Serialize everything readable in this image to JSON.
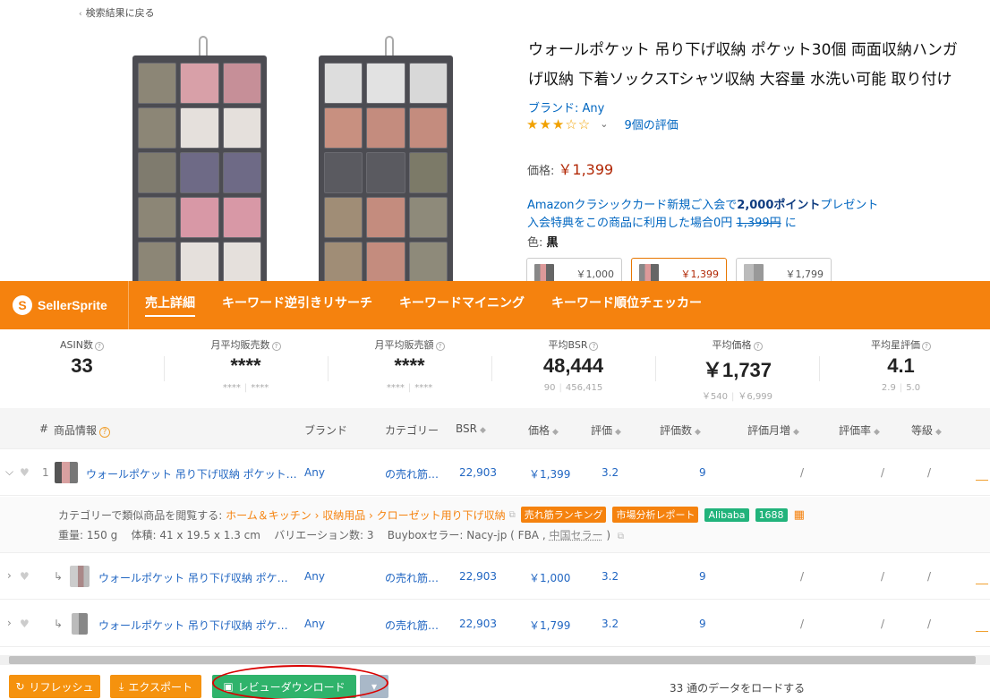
{
  "breadcrumb": {
    "back_label": "検索結果に戻る"
  },
  "product": {
    "title_line1": "ウォールポケット 吊り下げ収納 ポケット30個 両面収納ハンガ",
    "title_line2": "げ収納 下着ソックスTシャツ収納 大容量 水洗い可能 取り付け",
    "brand": "ブランド: Any",
    "stars": "★★★☆☆",
    "review_count": "9個の評価",
    "price_label": "価格:",
    "price": "￥1,399",
    "promo_line1_prefix": "Amazonクラシックカード新規ご入会で",
    "promo_points": "2,000ポイント",
    "promo_line1_suffix": "プレゼント",
    "promo_line2_prefix": "入会特典をこの商品に利用した場合0円",
    "promo_strike": "1,399円",
    "promo_line2_suffix": "に",
    "color_label": "色:",
    "color_value": "黒",
    "variants": [
      {
        "price": "￥1,000"
      },
      {
        "price": "￥1,399"
      },
      {
        "price": "￥1,799"
      }
    ]
  },
  "sellersprite": {
    "logo": "SellerSprite",
    "nav": [
      "売上詳細",
      "キーワード逆引きリサーチ",
      "キーワードマイニング",
      "キーワード順位チェッカー"
    ]
  },
  "stats": [
    {
      "label": "ASIN数",
      "value": "33",
      "min": "",
      "max": ""
    },
    {
      "label": "月平均販売数",
      "value": "****",
      "min": "****",
      "max": "****"
    },
    {
      "label": "月平均販売額",
      "value": "****",
      "min": "****",
      "max": "****"
    },
    {
      "label": "平均BSR",
      "value": "48,444",
      "min": "90",
      "max": "456,415"
    },
    {
      "label": "平均価格",
      "value": "￥1,737",
      "min": "￥540",
      "max": "￥6,999"
    },
    {
      "label": "平均星評価",
      "value": "4.1",
      "min": "2.9",
      "max": "5.0"
    }
  ],
  "table": {
    "headers": {
      "num": "#",
      "info": "商品情報",
      "brand": "ブランド",
      "category": "カテゴリー",
      "bsr": "BSR",
      "price": "価格",
      "rating": "評価",
      "reviews": "評価数",
      "review_growth": "評価月増",
      "review_rate": "評価率",
      "grade": "等級"
    },
    "rows": [
      {
        "num": "1",
        "title": "ウォールポケット 吊り下げ収納 ポケット…",
        "brand": "Any",
        "category": "の売れ筋…",
        "bsr": "22,903",
        "price": "￥1,399",
        "rating": "3.2",
        "reviews": "9",
        "growth": "/",
        "rate": "/",
        "grade": "/"
      },
      {
        "num": "",
        "title": "ウォールポケット 吊り下げ収納 ポケ…",
        "brand": "Any",
        "category": "の売れ筋…",
        "bsr": "22,903",
        "price": "￥1,000",
        "rating": "3.2",
        "reviews": "9",
        "growth": "/",
        "rate": "/",
        "grade": "/"
      },
      {
        "num": "",
        "title": "ウォールポケット 吊り下げ収納 ポケ…",
        "brand": "Any",
        "category": "の売れ筋…",
        "bsr": "22,903",
        "price": "￥1,799",
        "rating": "3.2",
        "reviews": "9",
        "growth": "/",
        "rate": "/",
        "grade": "/"
      }
    ],
    "detail": {
      "browse_label": "カテゴリーで類似商品を閲覧する:",
      "category_path": "ホーム＆キッチン › 収納用品 › クローゼット用り下げ収納",
      "tags": [
        "売れ筋ランキング",
        "市場分析レポート",
        "Alibaba",
        "1688"
      ],
      "weight": "重量: 150 g",
      "volume": "体積: 41 x 19.5 x 1.3 cm",
      "variations": "バリエーション数: 3",
      "buybox_prefix": "Buyboxセラー: Nacy-jp ( FBA ,",
      "buybox_seller": "中国セラー",
      "buybox_suffix": ")"
    }
  },
  "toolbar": {
    "refresh": "リフレッシュ",
    "export": "エクスポート",
    "review_download": "レビューダウンロード",
    "load_text": "33 通のデータをロードする"
  },
  "colors": {
    "accent": "#f5820e",
    "link": "#2166c2",
    "green": "#2fb36b",
    "price_red": "#b12704",
    "annotation": "#d90000"
  }
}
